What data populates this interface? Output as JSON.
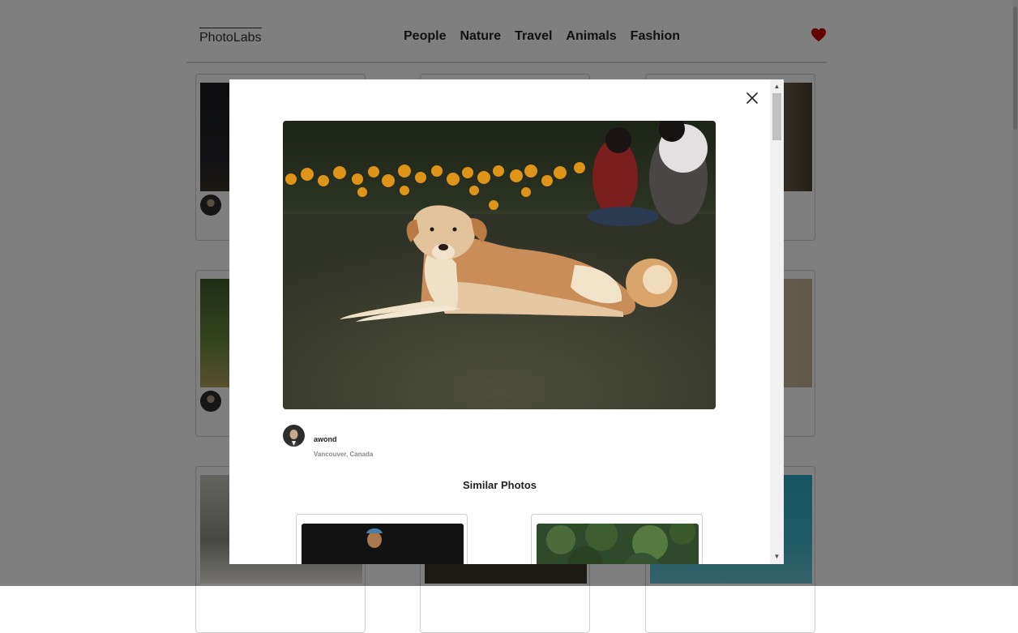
{
  "header": {
    "logo": "PhotoLabs",
    "topics": [
      "People",
      "Nature",
      "Travel",
      "Animals",
      "Fashion"
    ],
    "favourite_icon": "heart-icon",
    "favourite_color": "#c40000"
  },
  "modal": {
    "close_icon": "close-icon",
    "photo": {
      "subject": "dog-lying-on-grass"
    },
    "author": {
      "username": "awond",
      "location": "Vancouver, Canada"
    },
    "similar_title": "Similar Photos"
  }
}
